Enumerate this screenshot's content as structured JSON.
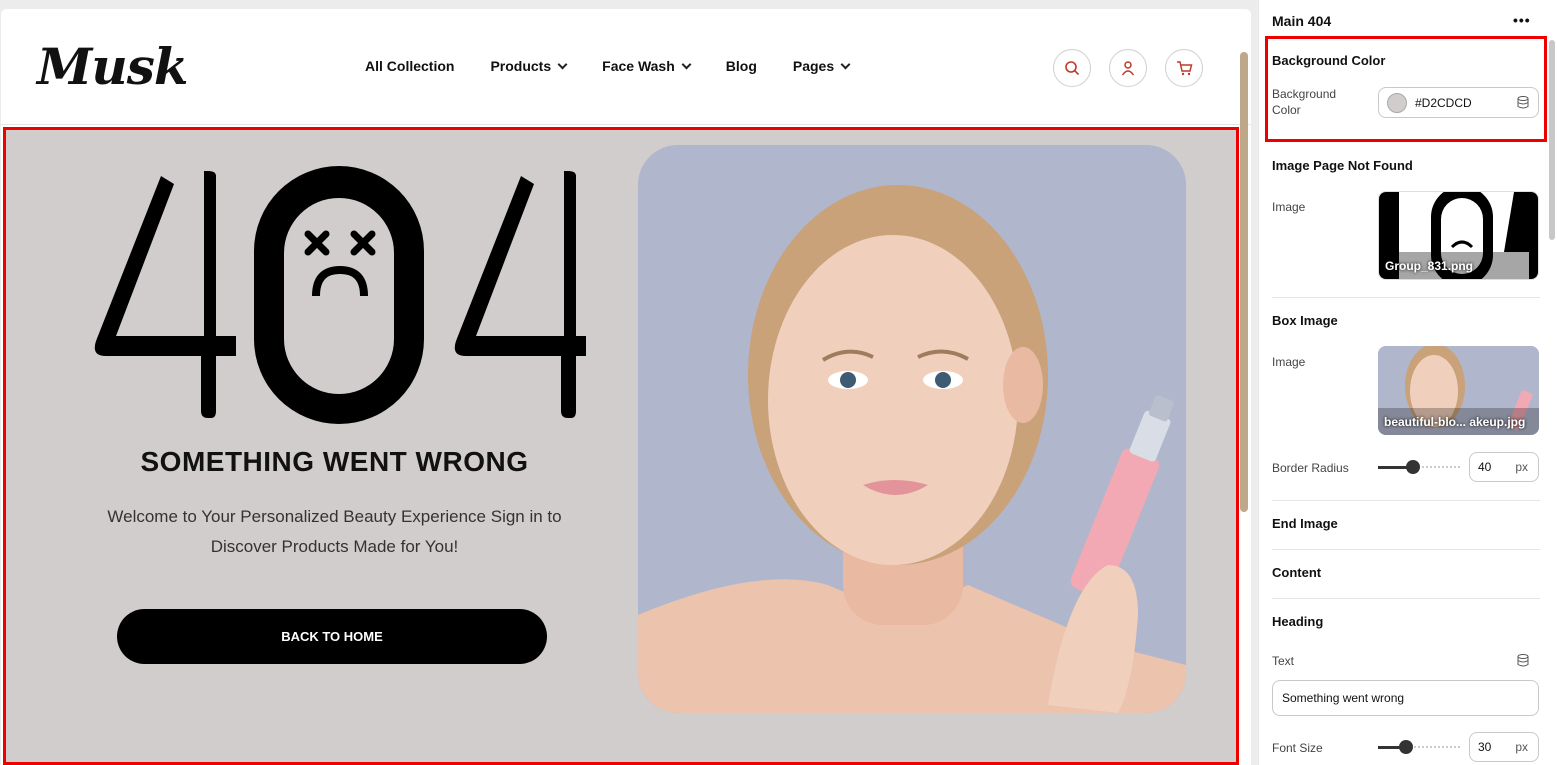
{
  "header": {
    "logo": "Musk",
    "nav": [
      {
        "label": "All Collection",
        "dropdown": false
      },
      {
        "label": "Products",
        "dropdown": true
      },
      {
        "label": "Face Wash",
        "dropdown": true
      },
      {
        "label": "Blog",
        "dropdown": false
      },
      {
        "label": "Pages",
        "dropdown": true
      }
    ],
    "icons": [
      "search-icon",
      "user-icon",
      "cart-icon"
    ]
  },
  "hero": {
    "big_text": "404",
    "heading": "SOMETHING WENT WRONG",
    "text": "Welcome to Your Personalized Beauty Experience Sign in to Discover Products Made for You!",
    "button": "BACK TO HOME",
    "background": "#D2CDCD"
  },
  "panel": {
    "title": "Main 404",
    "background_section": {
      "title": "Background Color",
      "label": "Background Color",
      "value": "#D2CDCD"
    },
    "image_section": {
      "title": "Image Page Not Found",
      "label": "Image",
      "filename": "Group_831.png"
    },
    "box_image": {
      "title": "Box Image",
      "label": "Image",
      "filename": "beautiful-blo... akeup.jpg",
      "radius_label": "Border Radius",
      "radius_value": "40",
      "radius_unit": "px",
      "radius_level": 0.4
    },
    "end_image": {
      "title": "End Image"
    },
    "content": {
      "title": "Content"
    },
    "heading": {
      "title": "Heading",
      "text_label": "Text",
      "text_value": "Something went wrong",
      "size_label": "Font Size",
      "size_value": "30",
      "size_unit": "px",
      "size_level": 0.3
    }
  },
  "colors": {
    "highlight": "#e00000",
    "accent": "#c0392b"
  }
}
